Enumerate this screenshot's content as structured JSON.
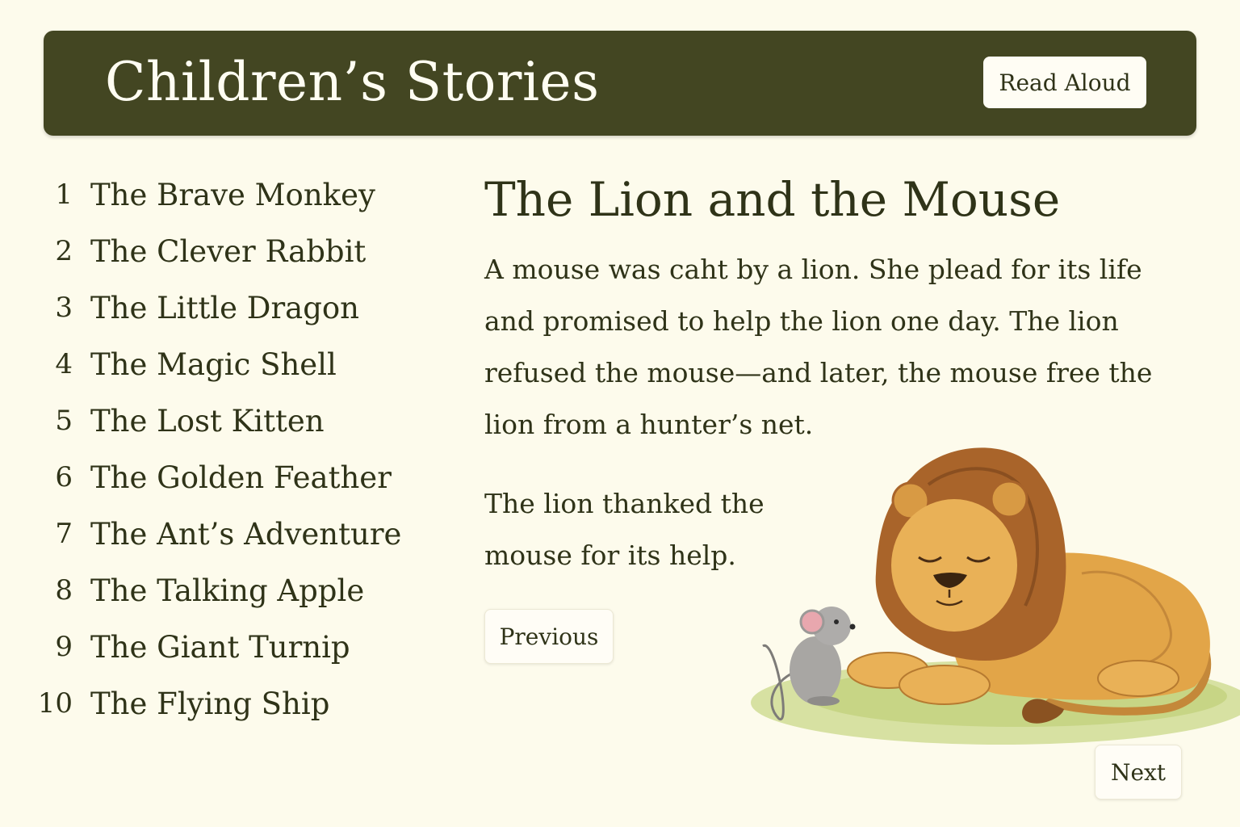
{
  "header": {
    "title": "Children’s Stories",
    "read_aloud_label": "Read Aloud"
  },
  "story_list": [
    {
      "number": "1",
      "title": "The Brave Monkey"
    },
    {
      "number": "2",
      "title": "The Clever Rabbit"
    },
    {
      "number": "3",
      "title": "The Little Dragon"
    },
    {
      "number": "4",
      "title": "The Magic Shell"
    },
    {
      "number": "5",
      "title": "The Lost Kitten"
    },
    {
      "number": "6",
      "title": "The Golden Feather"
    },
    {
      "number": "7",
      "title": "The Ant’s Adventure"
    },
    {
      "number": "8",
      "title": "The Talking Apple"
    },
    {
      "number": "9",
      "title": "The Giant Turnip"
    },
    {
      "number": "10",
      "title": "The Flying Ship"
    }
  ],
  "story": {
    "title": "The Lion and the Mouse",
    "paragraph_1": "A mouse was caht by a lion. She plead for its life and promised to help the lion one day. The lion refused the mouse—and later, the mouse free the lion from a hunter’s net.",
    "paragraph_2": "The lion thanked the mouse for its help."
  },
  "navigation": {
    "previous_label": "Previous",
    "next_label": "Next"
  },
  "colors": {
    "header_bg": "#434622",
    "page_bg": "#fdfbec",
    "text": "#2f3318"
  }
}
